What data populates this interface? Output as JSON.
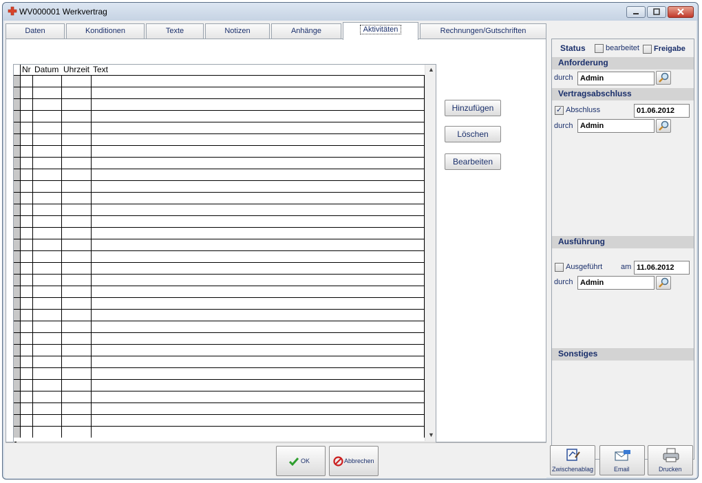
{
  "window": {
    "title": "WV000001 Werkvertrag"
  },
  "tabs": [
    {
      "label": "Daten"
    },
    {
      "label": "Konditionen"
    },
    {
      "label": "Texte"
    },
    {
      "label": "Notizen"
    },
    {
      "label": "Anhänge"
    },
    {
      "label": "Aktivitäten"
    },
    {
      "label": "Rechnungen/Gutschriften"
    }
  ],
  "active_tab": "Aktivitäten",
  "grid": {
    "columns": [
      "Nr",
      "Datum",
      "Uhrzeit",
      "Text"
    ],
    "rows": []
  },
  "actions": {
    "add": "Hinzufügen",
    "delete": "Löschen",
    "edit": "Bearbeiten"
  },
  "status": {
    "heading": "Status",
    "bearbeitet_label": "bearbeitet",
    "bearbeitet_checked": false,
    "freigabe_label": "Freigabe",
    "freigabe_checked": false
  },
  "anforderung": {
    "heading": "Anforderung",
    "durch_label": "durch",
    "durch_value": "Admin"
  },
  "vertragsabschluss": {
    "heading": "Vertragsabschluss",
    "abschluss_label": "Abschluss",
    "abschluss_checked": true,
    "date": "01.06.2012",
    "durch_label": "durch",
    "durch_value": "Admin"
  },
  "ausfuehrung": {
    "heading": "Ausführung",
    "ausgefuehrt_label": "Ausgeführt",
    "ausgefuehrt_checked": false,
    "am_label": "am",
    "date": "11.06.2012",
    "durch_label": "durch",
    "durch_value": "Admin"
  },
  "sonstiges": {
    "heading": "Sonstiges"
  },
  "bottom": {
    "ok_label": "OK",
    "cancel_label": "Abbrechen",
    "clipboard_label": "Zwischenablag",
    "email_label": "Email",
    "print_label": "Drucken"
  },
  "colors": {
    "label_text": "#1a2f6b",
    "section_header": "#d3d3d3",
    "ok_check": "#2e9e2e",
    "cancel_red": "#cc1f1f"
  }
}
